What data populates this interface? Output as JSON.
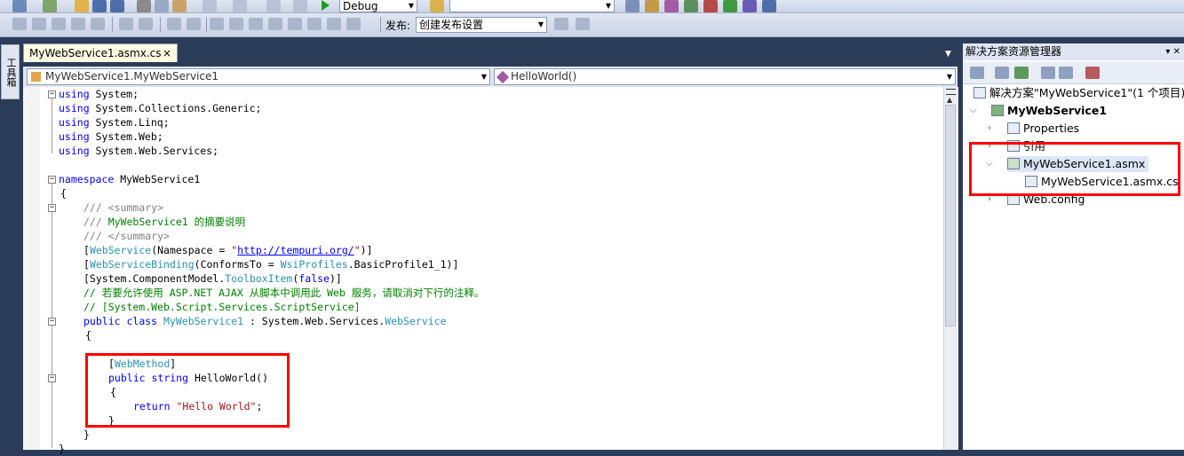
{
  "toolbar": {
    "config": "Debug",
    "publish_label": "发布:",
    "publish_value": "创建发布设置",
    "find_value": ""
  },
  "left_strip": {
    "toolbox_label": "工具箱"
  },
  "editor": {
    "tab_title": "MyWebService1.asmx.cs",
    "tab_close": "×",
    "nav_class": "MyWebService1.MyWebService1",
    "nav_member": "HelloWorld()"
  },
  "code": {
    "l1_kw": "using",
    "l1_rest": " System;",
    "l2_kw": "using",
    "l2_rest": " System.Collections.Generic;",
    "l3_kw": "using",
    "l3_rest": " System.Linq;",
    "l4_kw": "using",
    "l4_rest": " System.Web;",
    "l5_kw": "using",
    "l5_rest": " System.Web.Services;",
    "ns_kw": "namespace",
    "ns_name": " MyWebService1",
    "brace_open": "{",
    "brace_close": "}",
    "doc1": "/// <summary>",
    "doc2_a": "/// ",
    "doc2_b": "MyWebService1 的摘要说明",
    "doc3": "/// </summary>",
    "attr1_a": "[",
    "attr1_ty": "WebService",
    "attr1_b": "(Namespace = ",
    "attr1_q1": "\"",
    "attr1_url": "http://tempuri.org/",
    "attr1_q2": "\"",
    "attr1_c": ")]",
    "attr2_a": "[",
    "attr2_ty": "WebServiceBinding",
    "attr2_b": "(ConformsTo = ",
    "attr2_ty2": "WsiProfiles",
    "attr2_c": ".BasicProfile1_1)]",
    "attr3_a": "[System.ComponentModel.",
    "attr3_ty": "ToolboxItem",
    "attr3_b": "(",
    "attr3_kw": "false",
    "attr3_c": ")]",
    "cm1": "// 若要允许使用 ASP.NET AJAX 从脚本中调用此 Web 服务，请取消对下行的注释。",
    "cm2": "// [System.Web.Script.Services.ScriptService]",
    "cls_kw1": "public",
    "cls_kw2": " class",
    "cls_ty": " MyWebService1",
    "cls_b": " : System.Web.Services.",
    "cls_ty2": "WebService",
    "wm_a": "[",
    "wm_ty": "WebMethod",
    "wm_b": "]",
    "m_kw1": "public",
    "m_kw2": " string",
    "m_name": " HelloWorld()",
    "ret_kw": "return",
    "ret_str": " \"Hello World\"",
    "ret_end": ";"
  },
  "solution_explorer": {
    "title": "解决方案资源管理器",
    "pin": "▾ ✕",
    "solution": "解决方案\"MyWebService1\"(1 个项目)",
    "project": "MyWebService1",
    "properties": "Properties",
    "references": "引用",
    "asmx": "MyWebService1.asmx",
    "asmx_cs": "MyWebService1.asmx.cs",
    "webconfig": "Web.config"
  },
  "colors": {
    "highlight_box": "#ff0000",
    "keyword": "#0000ff",
    "type": "#2b91af",
    "comment": "#008000",
    "string": "#a31515"
  }
}
